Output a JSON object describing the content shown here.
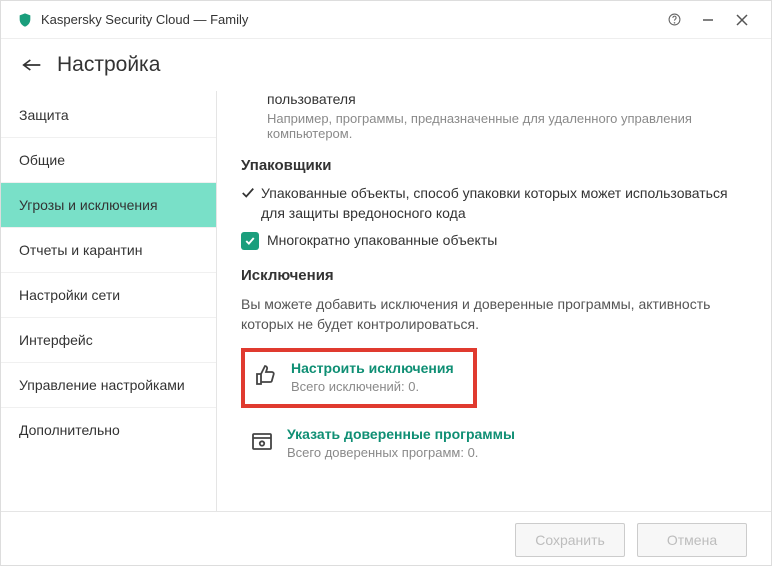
{
  "titlebar": {
    "title": "Kaspersky Security Cloud — Family"
  },
  "header": {
    "title": "Настройка"
  },
  "sidebar": {
    "items": [
      {
        "label": "Защита"
      },
      {
        "label": "Общие"
      },
      {
        "label": "Угрозы и исключения"
      },
      {
        "label": "Отчеты и карантин"
      },
      {
        "label": "Настройки сети"
      },
      {
        "label": "Интерфейс"
      },
      {
        "label": "Управление настройками"
      },
      {
        "label": "Дополнительно"
      }
    ]
  },
  "content": {
    "user_item": "пользователя",
    "user_desc": "Например, программы, предназначенные для удаленного управления компьютером.",
    "packers_title": "Упаковщики",
    "packers_item1": "Упакованные объекты, способ упаковки которых может использоваться для защиты вредоносного кода",
    "packers_item2": "Многократно упакованные объекты",
    "exclusions_title": "Исключения",
    "exclusions_desc": "Вы можете добавить исключения и доверенные программы, активность которых не будет контролироваться.",
    "configure_title": "Настроить исключения",
    "configure_sub": "Всего исключений: 0.",
    "trusted_title": "Указать доверенные программы",
    "trusted_sub": "Всего доверенных программ: 0."
  },
  "footer": {
    "save": "Сохранить",
    "cancel": "Отмена"
  }
}
